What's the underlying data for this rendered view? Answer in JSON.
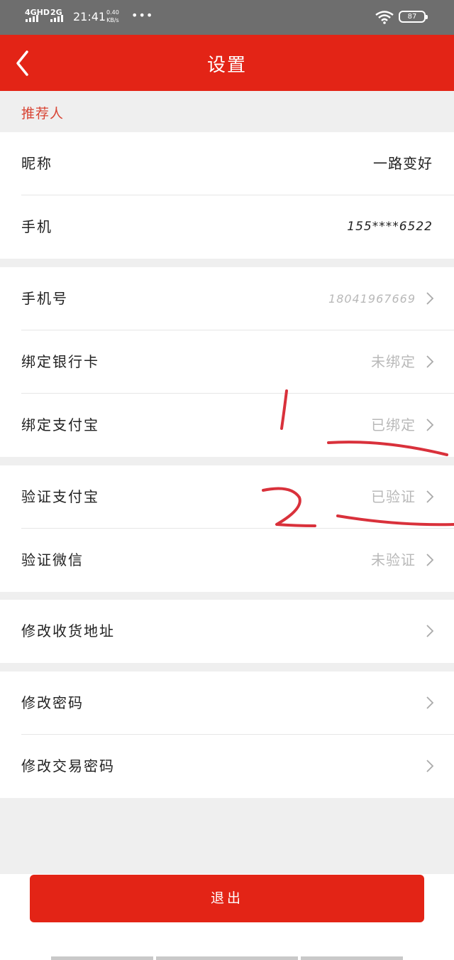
{
  "status_bar": {
    "network_1": "4GHD",
    "network_2": "2G",
    "time": "21:41",
    "speed_value": "0.40",
    "speed_unit": "KB/s",
    "more": "•••",
    "battery": "87"
  },
  "header": {
    "title": "设置"
  },
  "section": {
    "title": "推荐人"
  },
  "referrer": {
    "nickname_label": "昵称",
    "nickname_value": "一路变好",
    "phone_label": "手机",
    "phone_value": "155****6522"
  },
  "account": {
    "phone_label": "手机号",
    "phone_value": "18041967669",
    "bank_label": "绑定银行卡",
    "bank_value": "未绑定",
    "alipay_bind_label": "绑定支付宝",
    "alipay_bind_value": "已绑定"
  },
  "verify": {
    "alipay_label": "验证支付宝",
    "alipay_value": "已验证",
    "wechat_label": "验证微信",
    "wechat_value": "未验证"
  },
  "address": {
    "label": "修改收货地址"
  },
  "password": {
    "login_label": "修改密码",
    "trade_label": "修改交易密码"
  },
  "logout": {
    "label": "退出"
  },
  "colors": {
    "brand_red": "#e32416",
    "section_title": "#d84535",
    "value_gray": "#b9b9b9",
    "annotation_red": "#d9313b"
  }
}
